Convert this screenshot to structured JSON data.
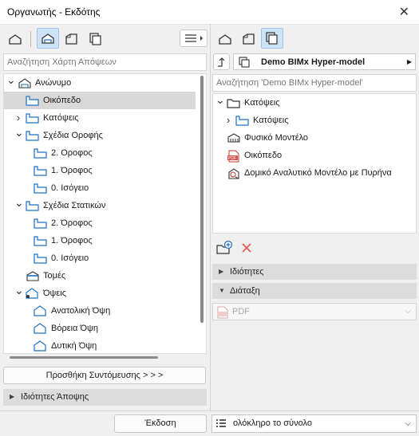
{
  "window": {
    "title": "Οργανωτής - Εκδότης",
    "close_glyph": "✕"
  },
  "left": {
    "search_placeholder": "Αναζήτηση Χάρτη Απόψεων",
    "tree": [
      {
        "label": "Ανώνυμο",
        "icon": "project-map-icon",
        "level": 0,
        "chevron": "down",
        "name": "tree-item-anonymous"
      },
      {
        "label": "Οικόπεδο",
        "icon": "view-folder-icon",
        "level": 1,
        "chevron": "",
        "name": "tree-item-site",
        "selected": true
      },
      {
        "label": "Κατόψεις",
        "icon": "view-folder-icon",
        "level": 1,
        "chevron": "right",
        "name": "tree-item-floorplans"
      },
      {
        "label": "Σχέδια Οροφής",
        "icon": "view-folder-icon",
        "level": 1,
        "chevron": "down",
        "name": "tree-item-ceiling-plans"
      },
      {
        "label": "2. Οροφος",
        "icon": "view-folder-icon",
        "level": 2,
        "chevron": "",
        "name": "tree-item-ceiling-floor2"
      },
      {
        "label": "1. Όροφος",
        "icon": "view-folder-icon",
        "level": 2,
        "chevron": "",
        "name": "tree-item-ceiling-floor1"
      },
      {
        "label": "0. Ισόγειο",
        "icon": "view-folder-icon",
        "level": 2,
        "chevron": "",
        "name": "tree-item-ceiling-ground"
      },
      {
        "label": "Σχέδια Στατικών",
        "icon": "view-folder-icon",
        "level": 1,
        "chevron": "down",
        "name": "tree-item-structural"
      },
      {
        "label": "2. Όροφος",
        "icon": "view-folder-icon",
        "level": 2,
        "chevron": "",
        "name": "tree-item-structural-floor2"
      },
      {
        "label": "1. Όροφος",
        "icon": "view-folder-icon",
        "level": 2,
        "chevron": "",
        "name": "tree-item-structural-floor1"
      },
      {
        "label": "0. Ισόγειο",
        "icon": "view-folder-icon",
        "level": 2,
        "chevron": "",
        "name": "tree-item-structural-ground"
      },
      {
        "label": "Τομές",
        "icon": "section-icon",
        "level": 1,
        "chevron": "",
        "name": "tree-item-sections"
      },
      {
        "label": "Όψεις",
        "icon": "elevation-folder-icon",
        "level": 1,
        "chevron": "down",
        "name": "tree-item-elevations"
      },
      {
        "label": "Ανατολική Όψη",
        "icon": "elevation-icon",
        "level": 2,
        "chevron": "",
        "name": "tree-item-east-elevation"
      },
      {
        "label": "Βόρεια Όψη",
        "icon": "elevation-icon",
        "level": 2,
        "chevron": "",
        "name": "tree-item-north-elevation"
      },
      {
        "label": "Δυτική Όψη",
        "icon": "elevation-icon",
        "level": 2,
        "chevron": "",
        "name": "tree-item-west-elevation"
      }
    ],
    "add_shortcut_label": "Προσθήκη Συντόμευσης > > >",
    "view_props_label": "Ιδιότητες Άποψης"
  },
  "right": {
    "set_dropdown": "Demo BIMx Hyper-model",
    "search_placeholder": "Αναζήτηση 'Demo BIMx Hyper-model'",
    "tree": [
      {
        "label": "Κατόψεις",
        "icon": "folder-icon",
        "level": 0,
        "chevron": "down"
      },
      {
        "label": "Κατόψεις",
        "icon": "view-folder-icon",
        "level": 1,
        "chevron": "right"
      },
      {
        "label": "Φυσικό Μοντέλο",
        "icon": "model-3d-icon",
        "level": 0,
        "chevron": ""
      },
      {
        "label": "Οικόπεδο",
        "icon": "pdf-icon",
        "level": 0,
        "chevron": ""
      },
      {
        "label": "Δομικό Αναλυτικό Μοντέλο με Πυρήνα",
        "icon": "analytical-model-icon",
        "level": 0,
        "chevron": ""
      }
    ],
    "properties_label": "Ιδιότητες",
    "layout_label": "Διάταξη",
    "format_value": "PDF"
  },
  "footer": {
    "publish_label": "Έκδοση",
    "scope_value": "ολόκληρο το σύνολο"
  },
  "colors": {
    "accent": "#1f6fc0",
    "selected_row": "#d9d9d9",
    "toggle_active": "#cfe3f6",
    "delete": "#e25b5b"
  }
}
